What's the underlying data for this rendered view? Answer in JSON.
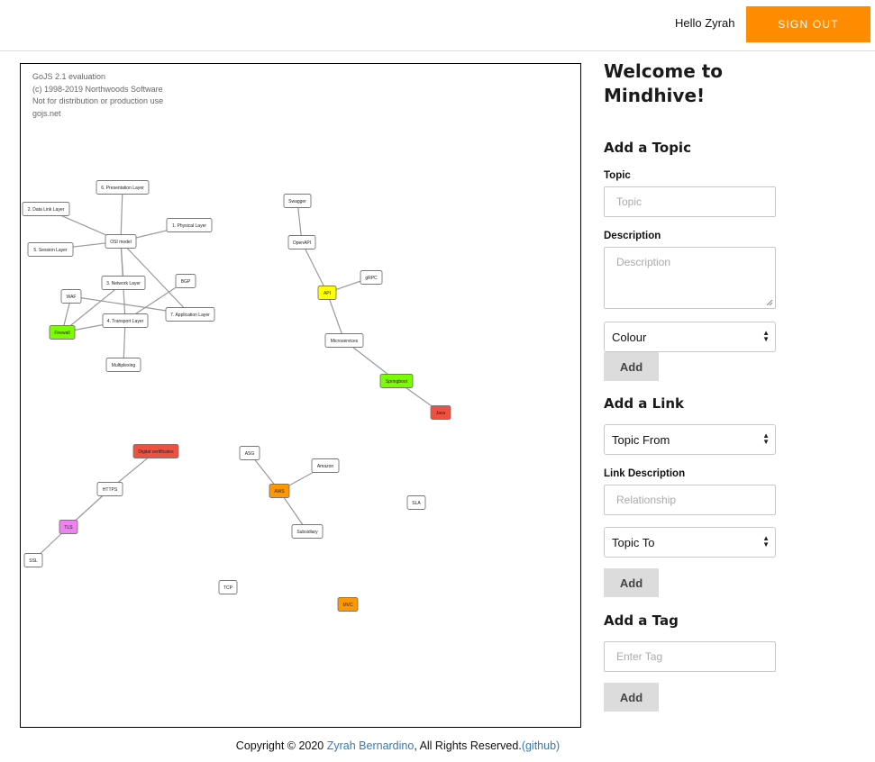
{
  "header": {
    "greeting": "Hello Zyrah",
    "signout_label": "SIGN OUT"
  },
  "diagram": {
    "watermark": "GoJS 2.1 evaluation\n(c) 1998-2019 Northwoods Software\nNot for distribution or production use\ngojs.net",
    "nodes": [
      {
        "id": "osi",
        "label": "OSI model",
        "color": "#ffffff"
      },
      {
        "id": "l6",
        "label": "6. Presentation Layer",
        "color": "#ffffff"
      },
      {
        "id": "l2",
        "label": "2. Data Link Layer",
        "color": "#ffffff"
      },
      {
        "id": "l1",
        "label": "1. Physical Layer",
        "color": "#ffffff"
      },
      {
        "id": "l5",
        "label": "5. Session Layer",
        "color": "#ffffff"
      },
      {
        "id": "l3",
        "label": "3. Network Layer",
        "color": "#ffffff"
      },
      {
        "id": "bgp",
        "label": "BGP",
        "color": "#ffffff"
      },
      {
        "id": "waf",
        "label": "WAF",
        "color": "#ffffff"
      },
      {
        "id": "l7",
        "label": "7. Application Layer",
        "color": "#ffffff"
      },
      {
        "id": "l4",
        "label": "4. Transport Layer",
        "color": "#ffffff"
      },
      {
        "id": "firewall",
        "label": "Firewall",
        "color": "#7cfc00"
      },
      {
        "id": "mux",
        "label": "Multiplexing",
        "color": "#ffffff"
      },
      {
        "id": "swagger",
        "label": "Swagger",
        "color": "#ffffff"
      },
      {
        "id": "openapi",
        "label": "OpenAPI",
        "color": "#ffffff"
      },
      {
        "id": "grpc",
        "label": "gRPC",
        "color": "#ffffff"
      },
      {
        "id": "api",
        "label": "API",
        "color": "#ffff00"
      },
      {
        "id": "micro",
        "label": "Microservices",
        "color": "#ffffff"
      },
      {
        "id": "spring",
        "label": "Springboot",
        "color": "#7cfc00"
      },
      {
        "id": "java",
        "label": "Java",
        "color": "#f05040"
      },
      {
        "id": "digcert",
        "label": "Digital certificates",
        "color": "#f05040"
      },
      {
        "id": "https",
        "label": "HTTPS",
        "color": "#ffffff"
      },
      {
        "id": "tls",
        "label": "TLS",
        "color": "#ee82ee"
      },
      {
        "id": "ssl",
        "label": "SSL",
        "color": "#ffffff"
      },
      {
        "id": "asg",
        "label": "ASG",
        "color": "#ffffff"
      },
      {
        "id": "amazon",
        "label": "Amazon",
        "color": "#ffffff"
      },
      {
        "id": "aws",
        "label": "AWS",
        "color": "#ff9800"
      },
      {
        "id": "subsidiary",
        "label": "Subsidiary",
        "color": "#ffffff"
      },
      {
        "id": "sla",
        "label": "SLA",
        "color": "#ffffff"
      },
      {
        "id": "tcp",
        "label": "TCP",
        "color": "#ffffff"
      },
      {
        "id": "mvc",
        "label": "MVC",
        "color": "#ff9800"
      }
    ],
    "links": [
      [
        "osi",
        "l6"
      ],
      [
        "osi",
        "l2"
      ],
      [
        "osi",
        "l1"
      ],
      [
        "osi",
        "l5"
      ],
      [
        "osi",
        "l3"
      ],
      [
        "osi",
        "l7"
      ],
      [
        "osi",
        "l4"
      ],
      [
        "l3",
        "firewall"
      ],
      [
        "waf",
        "firewall"
      ],
      [
        "waf",
        "l7"
      ],
      [
        "l4",
        "bgp"
      ],
      [
        "l4",
        "mux"
      ],
      [
        "l4",
        "firewall"
      ],
      [
        "swagger",
        "openapi"
      ],
      [
        "openapi",
        "api"
      ],
      [
        "api",
        "grpc"
      ],
      [
        "api",
        "micro"
      ],
      [
        "micro",
        "spring"
      ],
      [
        "spring",
        "java"
      ],
      [
        "digcert",
        "https"
      ],
      [
        "https",
        "tls"
      ],
      [
        "tls",
        "ssl"
      ],
      [
        "asg",
        "aws"
      ],
      [
        "amazon",
        "aws"
      ],
      [
        "aws",
        "subsidiary"
      ]
    ]
  },
  "sidebar": {
    "welcome": "Welcome to Mindhive!",
    "add_topic": {
      "title": "Add a Topic",
      "topic_label": "Topic",
      "topic_placeholder": "Topic",
      "description_label": "Description",
      "description_placeholder": "Description",
      "colour_selected": "Colour",
      "add_label": "Add"
    },
    "add_link": {
      "title": "Add a Link",
      "from_selected": "Topic From",
      "link_description_label": "Link Description",
      "relationship_placeholder": "Relationship",
      "to_selected": "Topic To",
      "add_label": "Add"
    },
    "add_tag": {
      "title": "Add a Tag",
      "tag_placeholder": "Enter Tag",
      "add_label": "Add"
    }
  },
  "footer": {
    "prefix": "Copyright © 2020 ",
    "author": "Zyrah Bernardino",
    "middle": ", All Rights Reserved.",
    "github": "(github)"
  }
}
